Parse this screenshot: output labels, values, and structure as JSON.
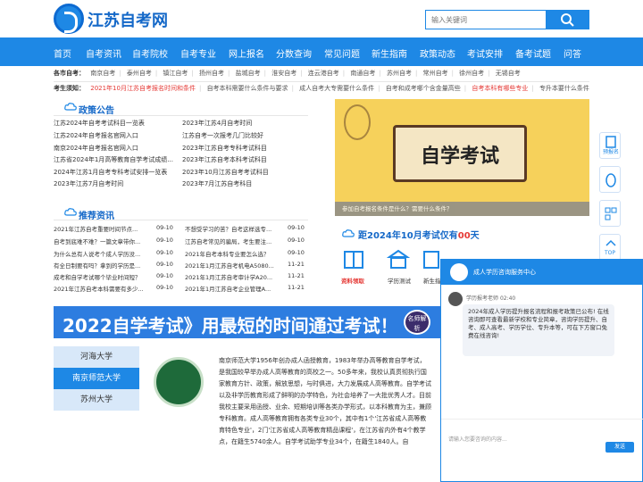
{
  "header": {
    "logo_text": "江苏自考网",
    "search_placeholder": "输入关键词"
  },
  "nav": [
    "首页",
    "自考资讯",
    "自考院校",
    "自考专业",
    "网上报名",
    "分数查询",
    "常见问题",
    "新生指南",
    "政策动态",
    "考试安排",
    "备考试题",
    "问答"
  ],
  "city_bar": {
    "label": "各市自考：",
    "cities": [
      "南京自考",
      "泰州自考",
      "镇江自考",
      "扬州自考",
      "盐城自考",
      "淮安自考",
      "连云港自考",
      "南通自考",
      "苏州自考",
      "常州自考",
      "徐州自考",
      "无锡自考"
    ]
  },
  "notice_bar": {
    "label": "考生须知：",
    "items": [
      "2021年10月江苏自考报名时间和条件",
      "自考本科需要什么条件与要求",
      "成人自考大专需要什么条件",
      "自考和成考哪个含金量高些",
      "自考本科有哪些专业",
      "专升本要什么条件"
    ]
  },
  "policy": {
    "title": "政策公告",
    "left": [
      "江苏2024年自考考试科目一览表",
      "江苏2024年自考报名官网入口",
      "南京2024年自考报名官网入口",
      "江苏省2024年1月高等教育自学考试成绩...",
      "2024年江苏1月自考专科考试安排一览表",
      "2023年江苏7月自考时间"
    ],
    "right": [
      "2023年江苏4月自考时间",
      "江苏自考一次报考几门比较好",
      "2023年江苏自考专科考试科目",
      "2023年江苏自考本科考试科目",
      "2023年10月江苏自考考试科目",
      "2023年7月江苏自考科目"
    ]
  },
  "recommend": {
    "title": "推荐资讯",
    "left": [
      {
        "t": "2021年江苏自考重要时间节点...",
        "d": "09-10"
      },
      {
        "t": "自考到底难不难？一篇文章带你...",
        "d": "09-10"
      },
      {
        "t": "为什么总有人说考个成人学历没...",
        "d": "09-10"
      },
      {
        "t": "有全日制要有吗？拿到的学历是...",
        "d": "09-10"
      },
      {
        "t": "成考和自学考试哪个毕业时间短？",
        "d": "09-10"
      },
      {
        "t": "2021年江苏自考本科需要有多少...",
        "d": "09-10"
      }
    ],
    "right": [
      {
        "t": "不想受学习的苦？自考这样选专...",
        "d": "09-10"
      },
      {
        "t": "江苏自考常见的骗局，考生要注...",
        "d": "09-10"
      },
      {
        "t": "2021年自考本科专业要怎么选？",
        "d": "09-10"
      },
      {
        "t": "2021年1月江苏自考机电A5080...",
        "d": "11-21"
      },
      {
        "t": "2021年1月江苏自考审计学A20...",
        "d": "11-21"
      },
      {
        "t": "2021年1月江苏自考企业管理A...",
        "d": "11-21"
      }
    ]
  },
  "banner": {
    "title": "自学考试",
    "caption": "参加自考报名条件是什么？需要什么条件？"
  },
  "countdown": {
    "prefix": "距2024年10月考试仅有",
    "days": "00",
    "suffix": "天"
  },
  "icons": [
    "资料领取",
    "学历测试",
    "新生指南"
  ],
  "side": [
    "预报名"
  ],
  "chat": {
    "title": "成人学历咨询服务中心",
    "agent": "学历报考老师",
    "time": "02:40",
    "message": "2024年成人学历提升报名流程和报考政策已公布! 在线咨询即可查看最新学校和专业简章，咨询学历提升、自考、成人高考、学历学位、专升本等，可在下方窗口免费在线咨询!",
    "placeholder": "请输入您要咨询的内容...",
    "send": "发送"
  },
  "ad": {
    "text": "2022自学考试》用最短的时间通过考试！",
    "badge": "名师解析"
  },
  "universities": [
    "河海大学",
    "南京师范大学",
    "苏州大学"
  ],
  "uni_text": "南京师范大学1956年创办成人函授教育，1983年举办高等教育自学考试，是我国较早举办成人高等教育的高校之一。50多年来，我校认真贯彻执行国家教育方针、政策，解放思想，与时俱进，大力发展成人高等教育。自学考试以及非学历教育形成了鲜明的办学特色，为社会培养了一大批优秀人才。目前我校主要采用函授、业余、短期培训等各类办学形式，以本科教育为主，兼顾专科教育。成人高等教育拥有各类专业30个，其中有1个'江苏省成人高等教育特色专业'，2门'江苏省成人高等教育精品课程'，在江苏省内外有4个教学点，在籍生5740余人。自学考试助学专业34个，在籍生1840人。自"
}
